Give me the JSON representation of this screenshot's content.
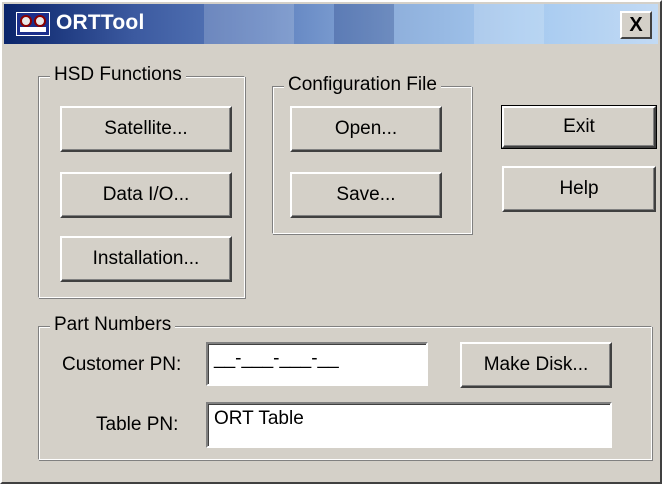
{
  "window": {
    "title": "ORTTool",
    "close_glyph": "X",
    "title_gradient_colors": [
      "#0a246a",
      "#a6caf0"
    ]
  },
  "hsd": {
    "legend": "HSD Functions",
    "satellite_label": "Satellite...",
    "data_io_label": "Data I/O...",
    "installation_label": "Installation..."
  },
  "config": {
    "legend": "Configuration File",
    "open_label": "Open...",
    "save_label": "Save..."
  },
  "actions": {
    "exit_label": "Exit",
    "help_label": "Help"
  },
  "part_numbers": {
    "legend": "Part Numbers",
    "customer_pn_label": "Customer PN:",
    "customer_pn_value": "__-___-___-__",
    "make_disk_label": "Make Disk...",
    "table_pn_label": "Table PN:",
    "table_pn_value": "ORT Table"
  }
}
